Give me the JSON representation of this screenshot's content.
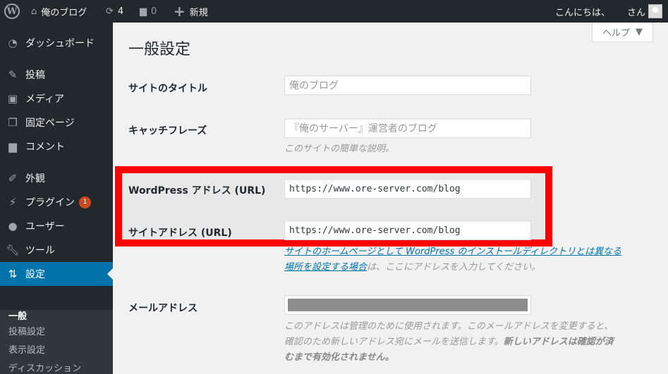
{
  "adminbar": {
    "site_name": "俺のブログ",
    "updates_count": "4",
    "comments_count": "0",
    "new_label": "新規",
    "greeting": "こんにちは、",
    "greeting_suffix": "さん"
  },
  "sidebar": {
    "items": [
      {
        "label": "ダッシュボード",
        "icon": "dashboard-icon"
      },
      {
        "label": "投稿",
        "icon": "pin-icon"
      },
      {
        "label": "メディア",
        "icon": "media-icon"
      },
      {
        "label": "固定ページ",
        "icon": "page-icon"
      },
      {
        "label": "コメント",
        "icon": "comment-icon"
      },
      {
        "label": "外観",
        "icon": "brush-icon"
      },
      {
        "label": "プラグイン",
        "icon": "plugin-icon",
        "badge": "1"
      },
      {
        "label": "ユーザー",
        "icon": "user-icon"
      },
      {
        "label": "ツール",
        "icon": "wrench-icon"
      },
      {
        "label": "設定",
        "icon": "settings-icon"
      }
    ],
    "submenu": [
      "一般",
      "投稿設定",
      "表示設定",
      "ディスカッション"
    ]
  },
  "help_label": "ヘルプ",
  "page_title": "一般設定",
  "fields": {
    "site_title": {
      "label": "サイトのタイトル",
      "value": "俺のブログ"
    },
    "tagline": {
      "label": "キャッチフレーズ",
      "value": "『俺のサーバー』運営者のブログ",
      "description": "このサイトの簡単な説明。"
    },
    "wp_address": {
      "label": "WordPress アドレス (URL)",
      "value": "https://www.ore-server.com/blog"
    },
    "site_address": {
      "label": "サイトアドレス (URL)",
      "value": "https://www.ore-server.com/blog",
      "description_link1": "サイトのホームページとして WordPress のインストールディレクトリとは異なる",
      "description_link2": "場所を設定する場合",
      "description_rest": "は、ここにアドレスを入力してください。"
    },
    "email": {
      "label": "メールアドレス",
      "description_1": "このアドレスは管理のために使用されます。このメールアドレスを変更すると、",
      "description_2": "確認のため新しいアドレス宛にメールを送信します。",
      "description_bold_1": "新しいアドレスは確認が済",
      "description_bold_2": "むまで有効化されません。"
    }
  },
  "colors": {
    "adminbar": "#23282d",
    "sidebar": "#23282d",
    "current_menu": "#0073aa",
    "highlight_border": "#ff0000",
    "badge": "#ca4a1f"
  }
}
